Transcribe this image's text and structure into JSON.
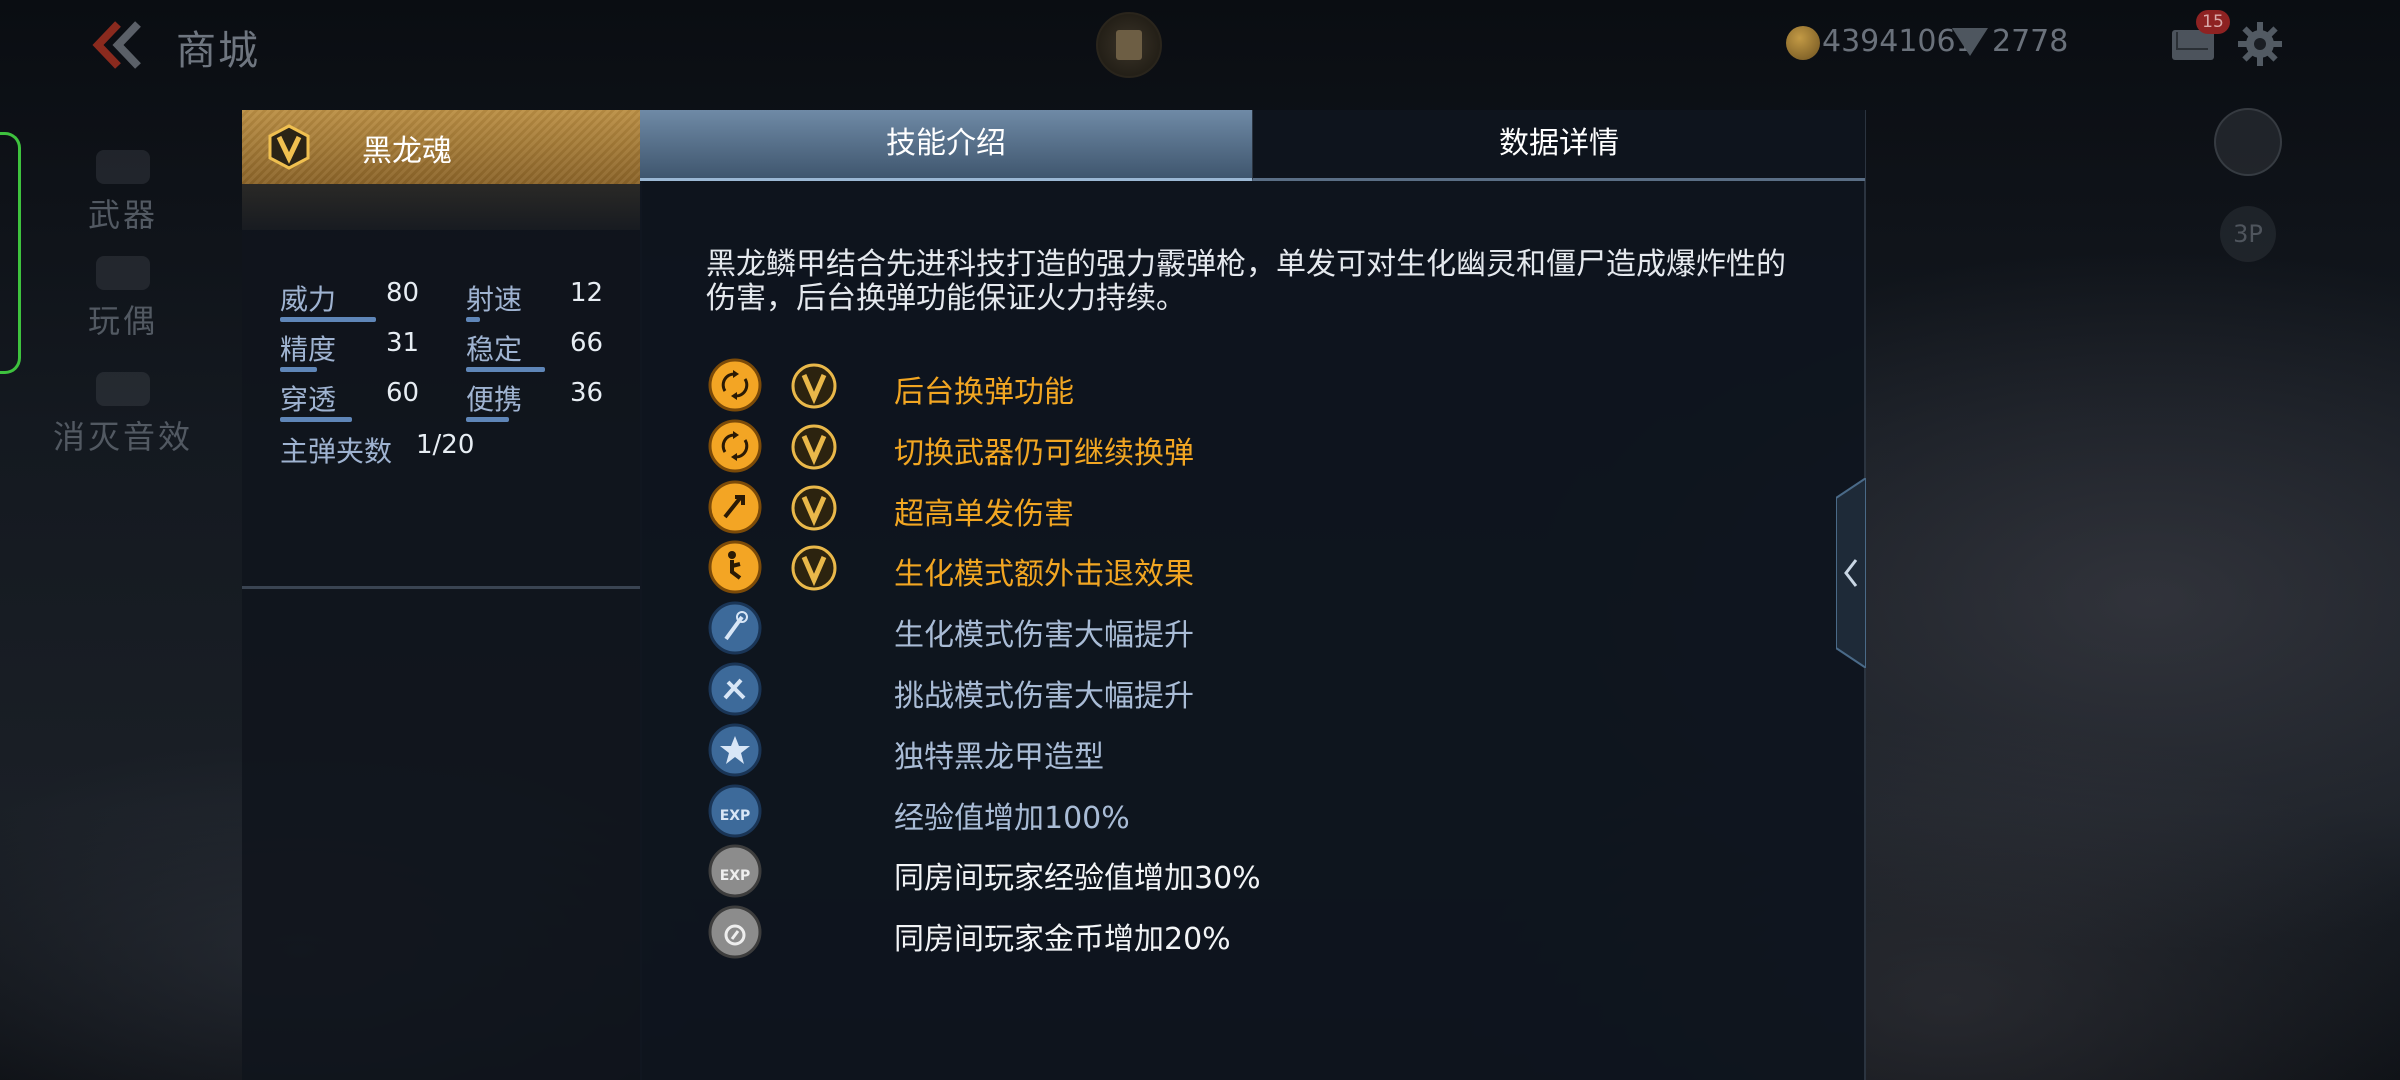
{
  "header": {
    "title": "商城",
    "gold": "43941061",
    "gems": "2778",
    "mail_badge": "15"
  },
  "nav": {
    "items": [
      {
        "label": "武器"
      },
      {
        "label": "玩偶"
      },
      {
        "label": "消灭音效"
      }
    ]
  },
  "right_buttons": {
    "view_label": "3P"
  },
  "weapon": {
    "name": "黑龙魂",
    "stats": [
      {
        "label": "威力",
        "value": "80",
        "level": 80
      },
      {
        "label": "射速",
        "value": "12",
        "level": 12
      },
      {
        "label": "精度",
        "value": "31",
        "level": 31
      },
      {
        "label": "稳定",
        "value": "66",
        "level": 66
      },
      {
        "label": "穿透",
        "value": "60",
        "level": 60
      },
      {
        "label": "便携",
        "value": "36",
        "level": 36
      }
    ],
    "magazine_label": "主弹夹数",
    "magazine_value": "1/20"
  },
  "tabs": [
    {
      "label": "技能介绍",
      "active": true
    },
    {
      "label": "数据详情",
      "active": false
    }
  ],
  "description": "黑龙鳞甲结合先进科技打造的强力霰弹枪，单发可对生化幽灵和僵尸造成爆炸性的伤害，后台换弹功能保证火力持续。",
  "features": [
    {
      "label": "后台换弹功能",
      "icon": "reload-icon",
      "vip": true,
      "color": "#f2a622"
    },
    {
      "label": "切换武器仍可继续换弹",
      "icon": "reload-icon",
      "vip": true,
      "color": "#f2a622"
    },
    {
      "label": "超高单发伤害",
      "icon": "damage-icon",
      "vip": true,
      "color": "#f2a622"
    },
    {
      "label": "生化模式额外击退效果",
      "icon": "knockback-icon",
      "vip": true,
      "color": "#f2a622"
    },
    {
      "label": "生化模式伤害大幅提升",
      "icon": "zombie-damage-icon",
      "vip": false,
      "color": "#a9bcd6"
    },
    {
      "label": "挑战模式伤害大幅提升",
      "icon": "challenge-damage-icon",
      "vip": false,
      "color": "#a9bcd6"
    },
    {
      "label": "独特黑龙甲造型",
      "icon": "star-icon",
      "vip": false,
      "color": "#a9bcd6"
    },
    {
      "label": "经验值增加100%",
      "icon": "exp-icon",
      "vip": false,
      "color": "#a9bcd6"
    },
    {
      "label": "同房间玩家经验值增加30%",
      "icon": "room-exp-icon",
      "vip": false,
      "color": "#f2f4f6"
    },
    {
      "label": "同房间玩家金币增加20%",
      "icon": "room-coin-icon",
      "vip": false,
      "color": "#f2f4f6"
    }
  ]
}
